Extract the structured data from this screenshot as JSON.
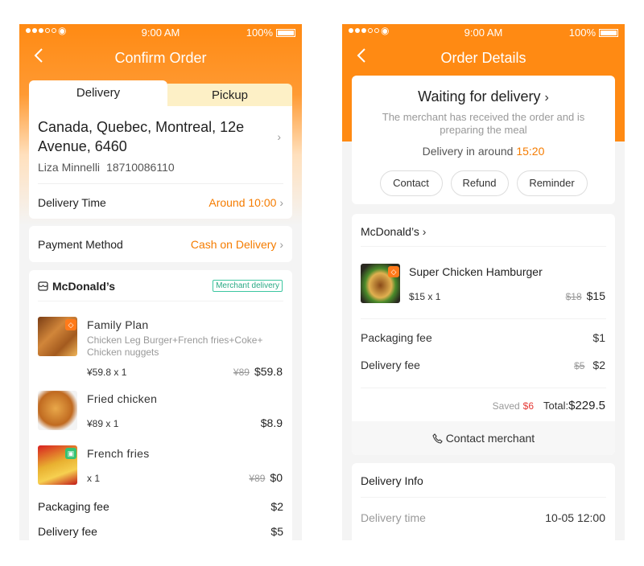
{
  "status_bar": {
    "time": "9:00 AM",
    "battery": "100%"
  },
  "confirm_order": {
    "title": "Confirm Order",
    "tabs": {
      "delivery": "Delivery",
      "pickup": "Pickup"
    },
    "address": {
      "line": "Canada, Quebec, Montreal, 12e Avenue, 6460",
      "name": "Liza Minnelli",
      "phone": "18710086110"
    },
    "delivery_time": {
      "label": "Delivery Time",
      "value": "Around 10:00"
    },
    "payment": {
      "label": "Payment Method",
      "value": "Cash on Delivery"
    },
    "shop": {
      "name": "McDonald’s",
      "badge": "Merchant delivery"
    },
    "items": [
      {
        "name": "Family Plan",
        "desc": "Chicken Leg Burger+French fries+Coke+ Chicken nuggets",
        "qty": "¥59.8 x 1",
        "old_price": "¥89",
        "price": "$59.8",
        "icon": "discount-tag-icon"
      },
      {
        "name": "Fried chicken",
        "desc": "",
        "qty": "¥89 x 1",
        "old_price": "",
        "price": "$8.9",
        "icon": ""
      },
      {
        "name": "French fries",
        "desc": "",
        "qty": "x 1",
        "old_price": "¥89",
        "price": "$0",
        "icon": "gift-icon"
      }
    ],
    "packaging": {
      "label": "Packaging fee",
      "value": "$2"
    },
    "delivery_fee": {
      "label": "Delivery fee",
      "value": "$5"
    }
  },
  "order_details": {
    "title": "Order Details",
    "status_title": "Waiting for delivery",
    "status_sub": "The merchant has received the order and is preparing the meal",
    "eta_label": "Delivery in around",
    "eta_time": "15:20",
    "buttons": {
      "contact": "Contact",
      "refund": "Refund",
      "reminder": "Reminder"
    },
    "shop": "McDonald’s",
    "item": {
      "name": "Super Chicken Hamburger",
      "qty": "$15 x 1",
      "old_price": "$18",
      "price": "$15"
    },
    "packaging": {
      "label": "Packaging fee",
      "value": "$1"
    },
    "delivery_fee": {
      "label": "Delivery fee",
      "old": "$5",
      "value": "$2"
    },
    "saved_label": "Saved",
    "saved_value": "$6",
    "total_label": "Total:",
    "total_value": "$229.5",
    "contact_merchant": "Contact merchant",
    "delivery_info": {
      "title": "Delivery Info",
      "time_label": "Delivery time",
      "time_value": "10-05 12:00"
    }
  },
  "colors": {
    "accent": "#ff8a13",
    "price_orange": "#f57c00",
    "saved_red": "#e53935",
    "badge_green": "#2aaa85"
  }
}
